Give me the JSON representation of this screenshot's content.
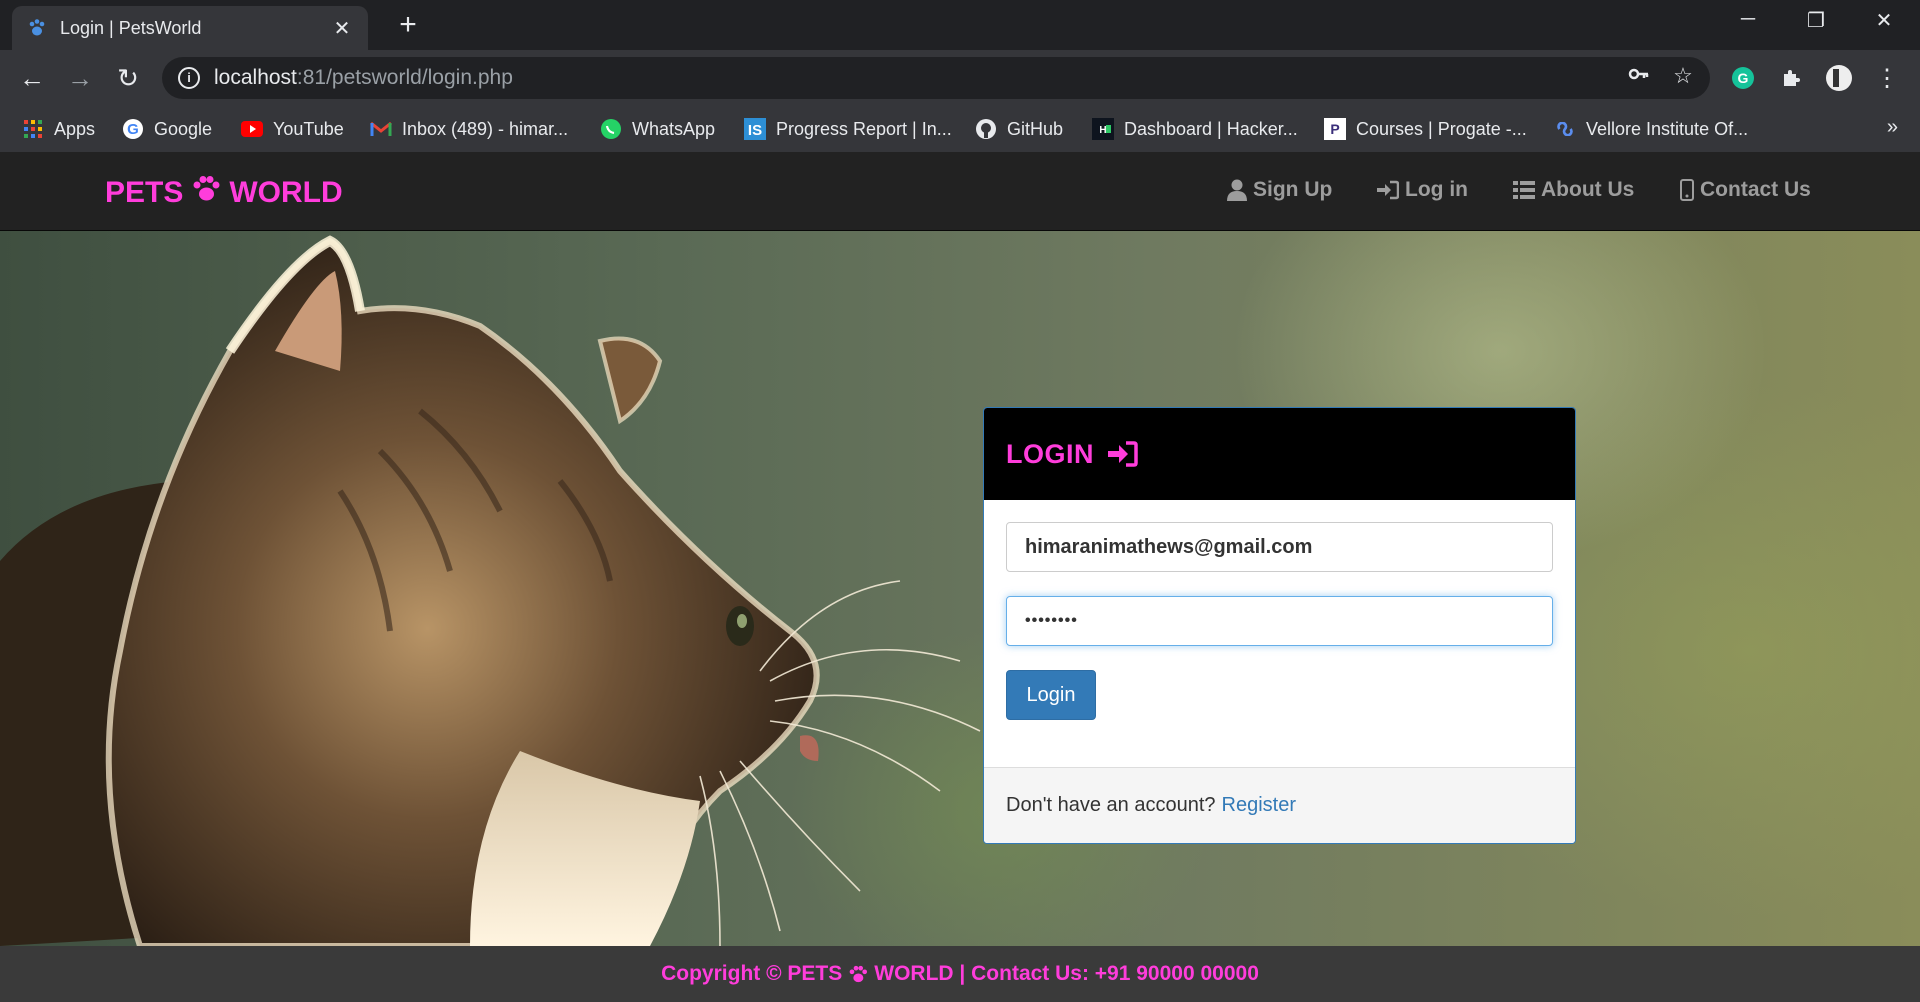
{
  "browser": {
    "tab_title": "Login | PetsWorld",
    "url_host": "localhost",
    "url_rest": ":81/petsworld/login.php",
    "bookmarks": [
      {
        "label": "Apps",
        "icon": "apps-grid-icon"
      },
      {
        "label": "Google",
        "icon": "google-icon"
      },
      {
        "label": "YouTube",
        "icon": "youtube-icon"
      },
      {
        "label": "Inbox (489) - himar...",
        "icon": "gmail-icon"
      },
      {
        "label": "WhatsApp",
        "icon": "whatsapp-icon"
      },
      {
        "label": "Progress Report | In...",
        "icon": "progress-report-icon"
      },
      {
        "label": "GitHub",
        "icon": "github-icon"
      },
      {
        "label": "Dashboard | Hacker...",
        "icon": "hackerrank-icon"
      },
      {
        "label": "Courses | Progate -...",
        "icon": "progate-icon"
      },
      {
        "label": "Vellore Institute Of...",
        "icon": "vit-icon"
      }
    ],
    "bookmarks_overflow": "»"
  },
  "navbar": {
    "brand_left": "PETS",
    "brand_right": "WORLD",
    "items": [
      {
        "label": "Sign Up",
        "icon": "user-icon"
      },
      {
        "label": "Log in",
        "icon": "login-icon"
      },
      {
        "label": "About Us",
        "icon": "list-icon"
      },
      {
        "label": "Contact Us",
        "icon": "mobile-icon"
      }
    ]
  },
  "login": {
    "title": "LOGIN",
    "email_value": "himaranimathews@gmail.com",
    "password_value": "••••••••",
    "button_label": "Login",
    "footer_text": "Don't have an account?",
    "register_link": "Register"
  },
  "footer": {
    "text_before": "Copyright © PETS",
    "text_after": "WORLD | Contact Us: +91 90000 00000"
  },
  "colors": {
    "brand_pink": "#ff3ddb",
    "primary_blue": "#337ab7",
    "navbar_bg": "#222222"
  }
}
